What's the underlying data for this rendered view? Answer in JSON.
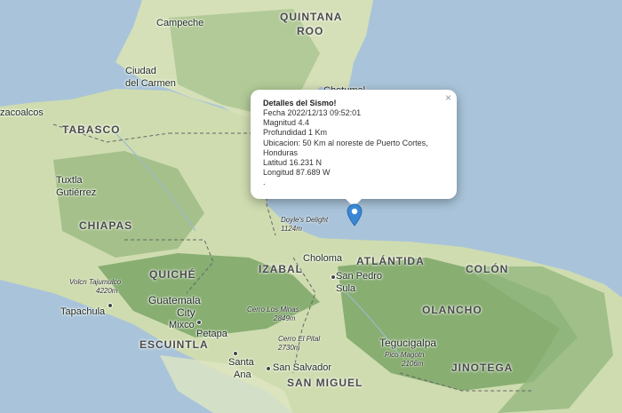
{
  "colors": {
    "water": "#a9c4da",
    "land_light": "#dfe6c4",
    "forest": "#8fb27a",
    "mountain": "#6c9a5e",
    "marker": "#3a87d6"
  },
  "popup": {
    "title": "Detalles del Sismo!",
    "fecha": "Fecha 2022/12/13 09:52:01",
    "magnitud": "Magnitud 4.4",
    "profundidad": "Profundidad 1 Km",
    "ubicacion_1": "Ubicacion: 50 Km al noreste de Puerto Cortes,",
    "ubicacion_2": "Honduras",
    "latitud": "Latitud 16.231 N",
    "longitud": "Longitud 87.689 W",
    "extra": ".",
    "close": "×"
  },
  "marker_icon": "map-pin-icon",
  "labels": {
    "campeche": "Campeche",
    "quintana": "QUINTANA",
    "roo": "ROO",
    "ciudad": "Ciudad",
    "del_carmen": "del Carmen",
    "coatzacoalcos": "zacoalcos",
    "chetumal": "Chetumal",
    "tabasco": "TABASCO",
    "tuxtla": "Tuxtla",
    "gutierrez": "Gutiérrez",
    "chiapas": "CHIAPAS",
    "doyles": "Doyle's Delight",
    "doyles_elev": "1124m",
    "izabal": "IZABAL",
    "choloma": "Choloma",
    "atlantida": "ATLÁNTIDA",
    "colon": "COLÓN",
    "quiche": "QUICHÉ",
    "volcan": "Volcn Tajumulco",
    "volcan_elev": "4220m",
    "guatemala": "Guatemala",
    "city": "City",
    "san_pedro": "San Pedro",
    "sula": "Sula",
    "olancho": "OLANCHO",
    "tapachula": "Tapachula",
    "cerro_minas": "Cerro Los Minas",
    "cerro_minas_elev": "2849m",
    "mixco": "Mixco",
    "petapa": "Petapa",
    "escuintla": "ESCUINTLA",
    "cerro_pital": "Cerro El Pital",
    "cerro_pital_elev": "2730m",
    "tegucigalpa": "Tegucigalpa",
    "pico": "Pico Magotn",
    "pico_elev": "2106m",
    "santa": "Santa",
    "ana": "Ana",
    "san_salvador": "San Salvador",
    "jinotega": "JINOTEGA",
    "san_miguel": "SAN MIGUEL"
  }
}
